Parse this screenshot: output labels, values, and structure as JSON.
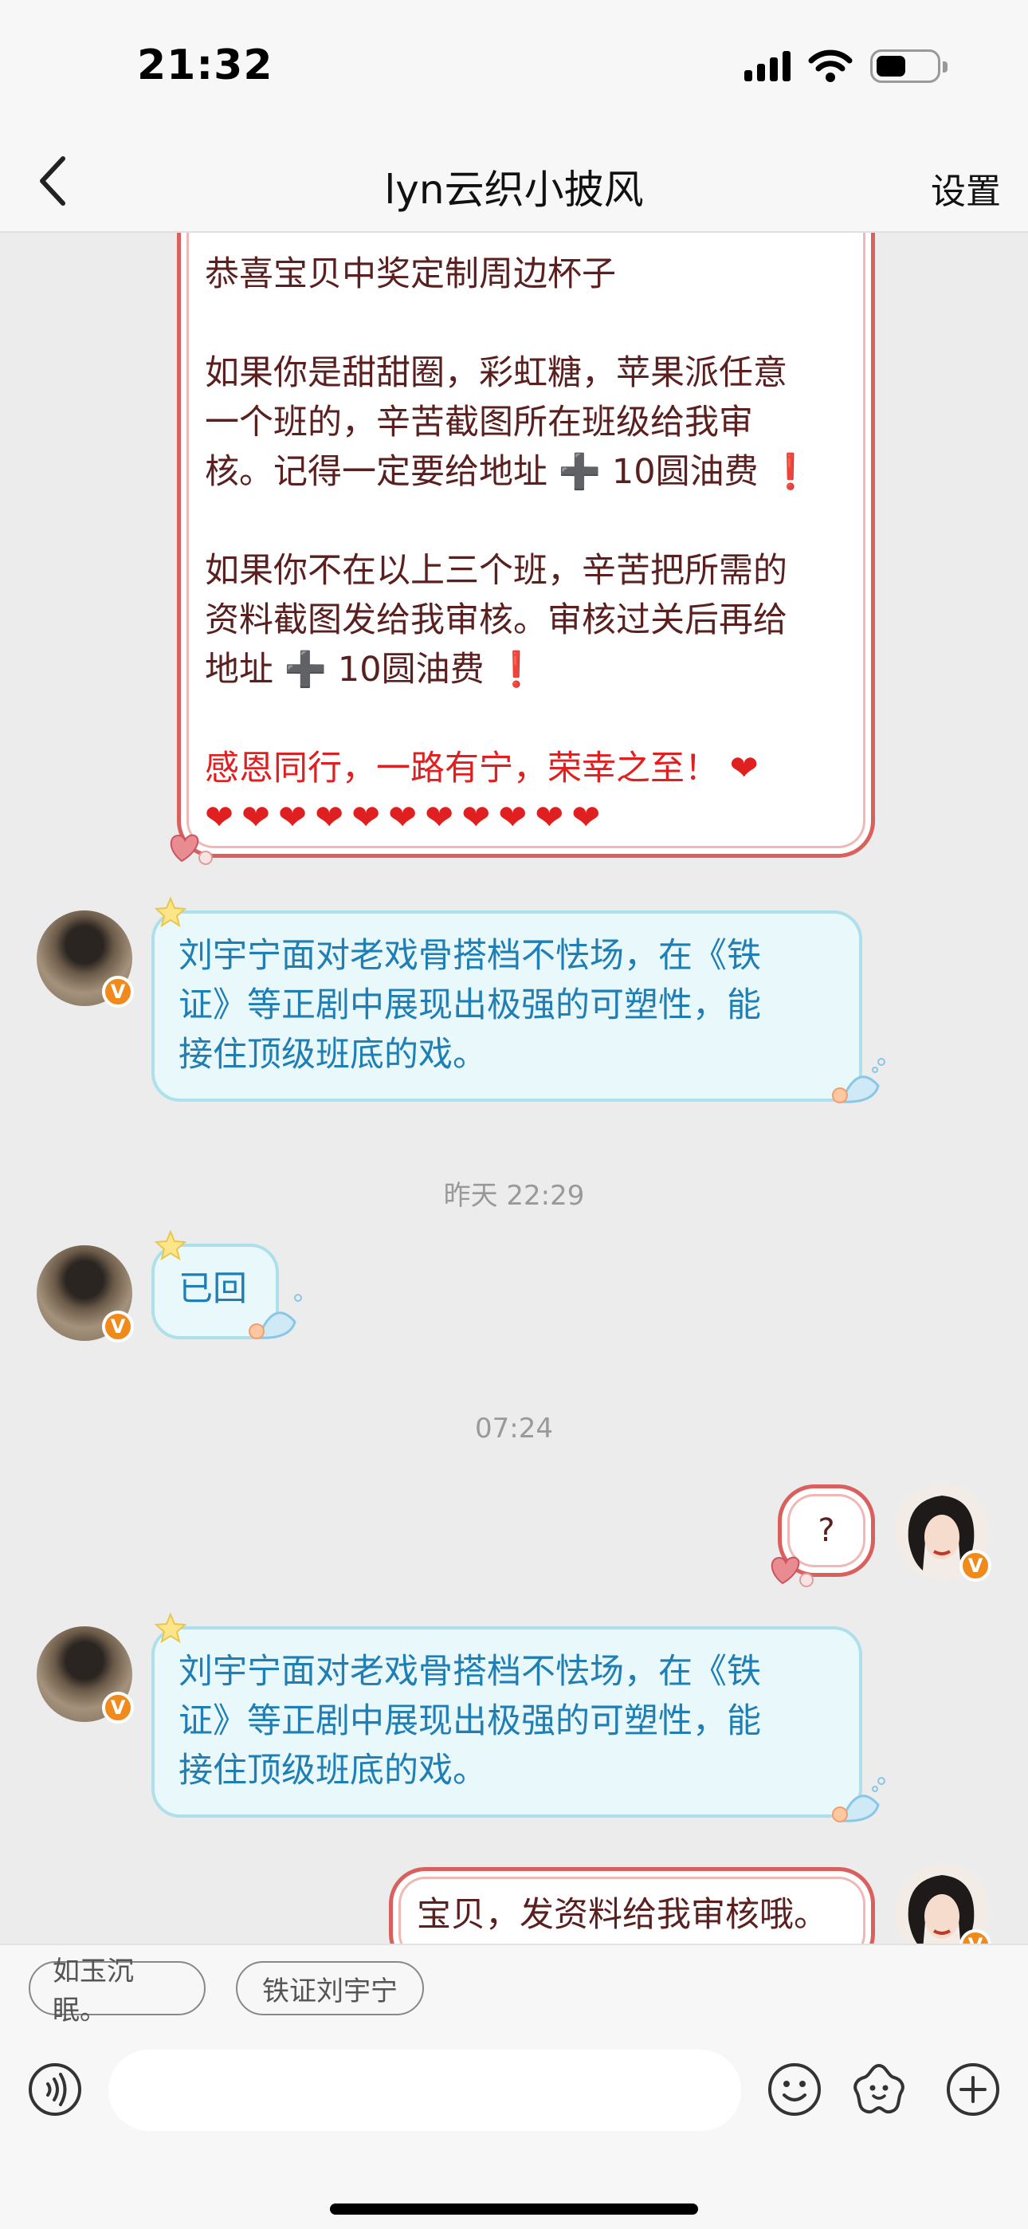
{
  "status": {
    "time": "21:32"
  },
  "nav": {
    "title": "lyn云织小披风",
    "settings": "设置"
  },
  "messages": {
    "m1": {
      "lines": [
        "恭喜宝贝中奖定制周边杯子",
        "",
        "如果你是甜甜圈，彩虹糖，苹果派任意",
        "一个班的，辛苦截图所在班级给我审",
        "核。记得一定要给地址 ➕ 10圆油费 ❗",
        "",
        "如果你不在以上三个班，辛苦把所需的",
        "资料截图发给我审核。审核过关后再给",
        "地址 ➕ 10圆油费 ❗",
        "",
        "感恩同行，一路有宁，荣幸之至！ ❤",
        "❤❤❤❤❤❤❤❤❤❤❤"
      ]
    },
    "m2": {
      "lines": [
        "刘宇宁面对老戏骨搭档不怯场，在《铁",
        "证》等正剧中展现出极强的可塑性，能",
        "接住顶级班底的戏。"
      ]
    },
    "ts1": "昨天 22:29",
    "m3": {
      "text": "已回"
    },
    "ts2": "07:24",
    "m4": {
      "text": "?"
    },
    "m5": {
      "lines": [
        "刘宇宁面对老戏骨搭档不怯场，在《铁",
        "证》等正剧中展现出极强的可塑性，能",
        "接住顶级班底的戏。"
      ]
    },
    "m6": {
      "text": "宝贝，发资料给我审核哦。"
    }
  },
  "badge": "V",
  "chips": [
    "如玉沉眠。",
    "铁证刘宇宁"
  ],
  "colors": {
    "red_border": "#d9605d",
    "blue_text": "#1f7fb5",
    "badge": "#f08a1c"
  }
}
